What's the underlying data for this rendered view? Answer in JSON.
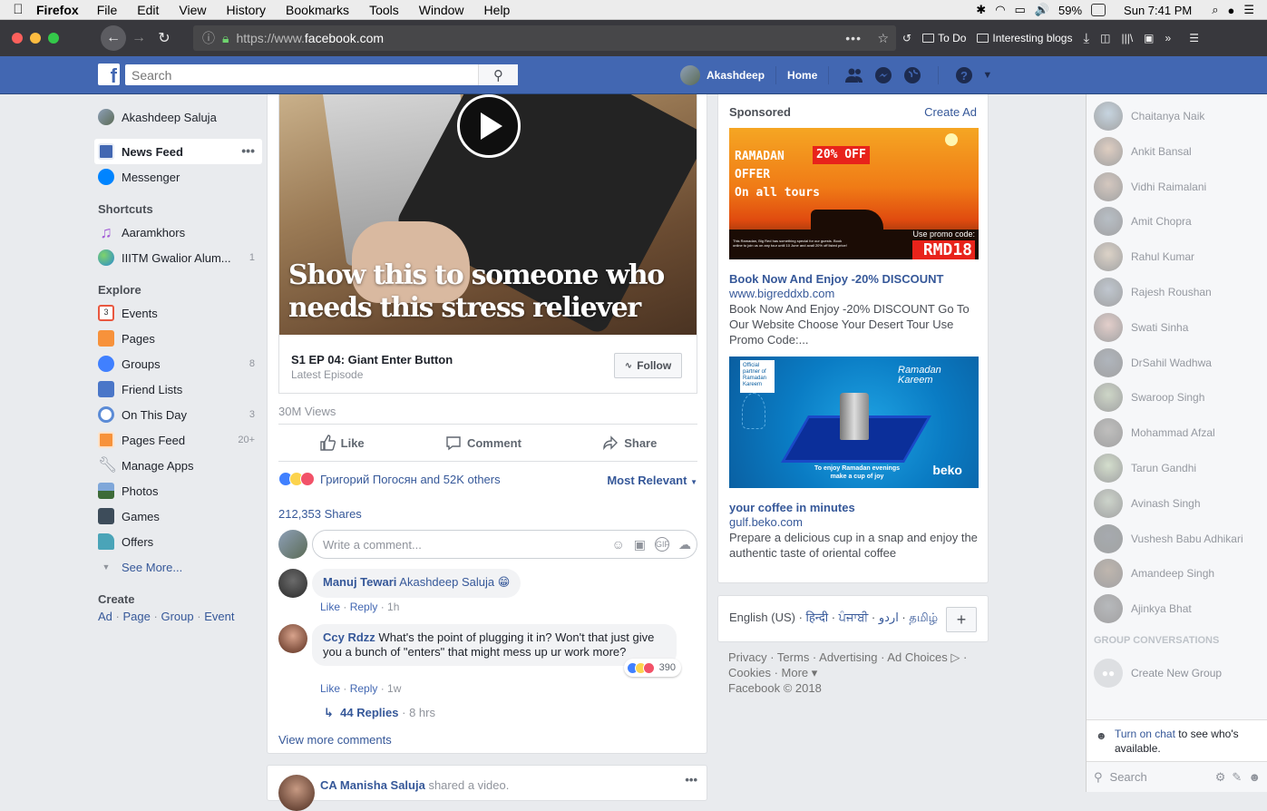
{
  "menubar": {
    "app": "Firefox",
    "items": [
      "File",
      "Edit",
      "View",
      "History",
      "Bookmarks",
      "Tools",
      "Window",
      "Help"
    ],
    "battery": "59%",
    "clock": "Sun 7:41 PM"
  },
  "browser": {
    "url_prefix": "https://www.",
    "url_host": "facebook.com",
    "bookmarks": [
      "To Do",
      "Interesting blogs"
    ]
  },
  "fb": {
    "search_placeholder": "Search",
    "user_short": "Akashdeep",
    "home": "Home"
  },
  "left": {
    "user": "Akashdeep Saluja",
    "top": [
      {
        "label": "News Feed",
        "icon": "news-feed-icon"
      },
      {
        "label": "Messenger",
        "icon": "messenger-icon"
      }
    ],
    "shortcuts_title": "Shortcuts",
    "shortcuts": [
      {
        "label": "Aaramkhors",
        "count": ""
      },
      {
        "label": "IIITM Gwalior Alum...",
        "count": "1"
      }
    ],
    "explore_title": "Explore",
    "explore": [
      {
        "label": "Events",
        "count": "",
        "icon": "calendar-icon",
        "color": "#e9573f"
      },
      {
        "label": "Pages",
        "count": "",
        "icon": "flag-icon",
        "color": "#f7923b"
      },
      {
        "label": "Groups",
        "count": "8",
        "icon": "groups-icon",
        "color": "#4080ff"
      },
      {
        "label": "Friend Lists",
        "count": "",
        "icon": "friend-list-icon",
        "color": "#4a76c8"
      },
      {
        "label": "On This Day",
        "count": "3",
        "icon": "clock-icon",
        "color": "#5b8bd6"
      },
      {
        "label": "Pages Feed",
        "count": "20+",
        "icon": "pages-feed-icon",
        "color": "#f7923b"
      },
      {
        "label": "Manage Apps",
        "count": "",
        "icon": "wrench-icon",
        "color": "#8d949e"
      },
      {
        "label": "Photos",
        "count": "",
        "icon": "photos-icon",
        "color": "#5a6e8a"
      },
      {
        "label": "Games",
        "count": "",
        "icon": "games-icon",
        "color": "#3d4c5a"
      },
      {
        "label": "Offers",
        "count": "",
        "icon": "offers-icon",
        "color": "#4aa4b8"
      }
    ],
    "see_more": "See More...",
    "create_title": "Create",
    "create_links": [
      "Ad",
      "Page",
      "Group",
      "Event"
    ]
  },
  "post": {
    "video_caption": "Show this to someone who needs this stress reliever",
    "episode_title": "S1 EP 04: Giant Enter Button",
    "episode_sub": "Latest Episode",
    "follow": "Follow",
    "views": "30M Views",
    "actions": [
      "Like",
      "Comment",
      "Share"
    ],
    "reactions_text": "Григорий Погосян and 52K others",
    "most_relevant": "Most Relevant",
    "shares": "212,353 Shares",
    "comment_placeholder": "Write a comment...",
    "comments": [
      {
        "name": "Manuj Tewari",
        "text": "Akashdeep Saluja 😁",
        "like": "Like",
        "reply": "Reply",
        "time": "1h"
      },
      {
        "name": "Ccy Rdzz",
        "text": "What's the point of plugging it in? Won't that just give you a bunch of \"enters\" that might mess up ur work more?",
        "like": "Like",
        "reply": "Reply",
        "time": "1w",
        "reactions": "390"
      }
    ],
    "replies": "44 Replies",
    "replies_time": "8 hrs",
    "view_more": "View more comments"
  },
  "post2": {
    "author": "CA Manisha Saluja",
    "text": "shared a video."
  },
  "ads": {
    "sponsored": "Sponsored",
    "create_ad": "Create Ad",
    "ad1": {
      "img_line1": "RAMADAN",
      "img_badge": "20% OFF",
      "img_line2": "OFFER",
      "img_line3": "On all tours",
      "img_promo_label": "Use promo code:",
      "img_promo_code": "RMD18",
      "img_fine": "This Ramadan, Big Red has something special for our guests. Book online to join us on any tour until 10 June and avail 20% off listed price!",
      "title": "Book Now And Enjoy -20% DISCOUNT",
      "url": "www.bigreddxb.com",
      "desc": "Book Now And Enjoy -20% DISCOUNT Go To Our Website Choose Your Desert Tour Use Promo Code:..."
    },
    "ad2": {
      "img_official": "Official partner of Ramadan Kareem",
      "img_rk": "Ramadan Kareem",
      "img_enjoy": "To enjoy Ramadan evenings make a cup of joy",
      "img_brand": "beko",
      "title": "your coffee in minutes",
      "url": "gulf.beko.com",
      "desc": "Prepare a delicious cup in a snap and enjoy the authentic taste of oriental coffee"
    }
  },
  "languages": {
    "current": "English (US)",
    "others": [
      "हिन्दी",
      "ਪੰਜਾਬੀ",
      "اردو",
      "தமிழ்"
    ]
  },
  "footer": {
    "line1": "Privacy · Terms · Advertising · Ad Choices ▷ ·",
    "line2": "Cookies · More ▾",
    "line3": "Facebook © 2018"
  },
  "chat": {
    "friends": [
      "Chaitanya Naik",
      "Ankit Bansal",
      "Vidhi Raimalani",
      "Amit Chopra",
      "Rahul Kumar",
      "Rajesh Roushan",
      "Swati Sinha",
      "DrSahil Wadhwa",
      "Swaroop Singh",
      "Mohammad Afzal",
      "Tarun Gandhi",
      "Avinash Singh",
      "Vushesh Babu Adhikari",
      "Amandeep Singh",
      "Ajinkya Bhat"
    ],
    "group_title": "GROUP CONVERSATIONS",
    "create_group": "Create New Group",
    "turn_on_link": "Turn on chat",
    "turn_on_rest": "to see who's available.",
    "search": "Search"
  }
}
